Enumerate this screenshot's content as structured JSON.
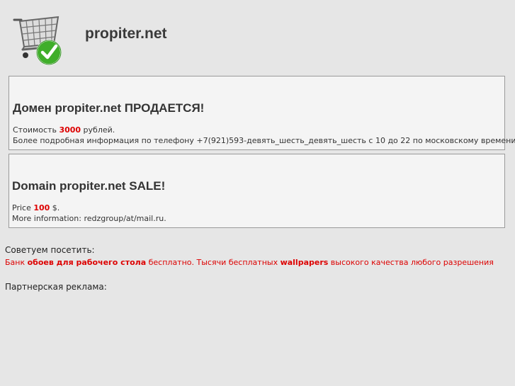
{
  "header": {
    "site_title": "propiter.net",
    "logo_icon": "shopping-cart-checkmark-icon"
  },
  "ru_box": {
    "heading": "Домен propiter.net ПРОДАЕТСЯ!",
    "price_prefix": "Стоимость ",
    "price_value": "3000",
    "price_suffix": " рублей.",
    "info": "Более подробная информация по телефону +7(921)593-девять_шесть_девять_шесть с 10 до 22 по московскому времени."
  },
  "en_box": {
    "heading": "Domain propiter.net SALE!",
    "price_prefix": "Price ",
    "price_value": "100",
    "price_suffix": " $.",
    "info": "More information: redzgroup/at/mail.ru."
  },
  "recommend": {
    "label": "Советуем посетить:",
    "text_1": "Банк ",
    "link_1": "обоев для рабочего стола",
    "text_2": " бесплатно. Тысячи бесплатных ",
    "link_2": "wallpapers",
    "text_3": " высокого качества любого разрешения"
  },
  "partner": {
    "label": "Партнерская реклама:"
  },
  "colors": {
    "background": "#e6e6e6",
    "box_background": "#f4f4f4",
    "accent_red": "#dd0000",
    "check_green": "#3fae2a"
  }
}
